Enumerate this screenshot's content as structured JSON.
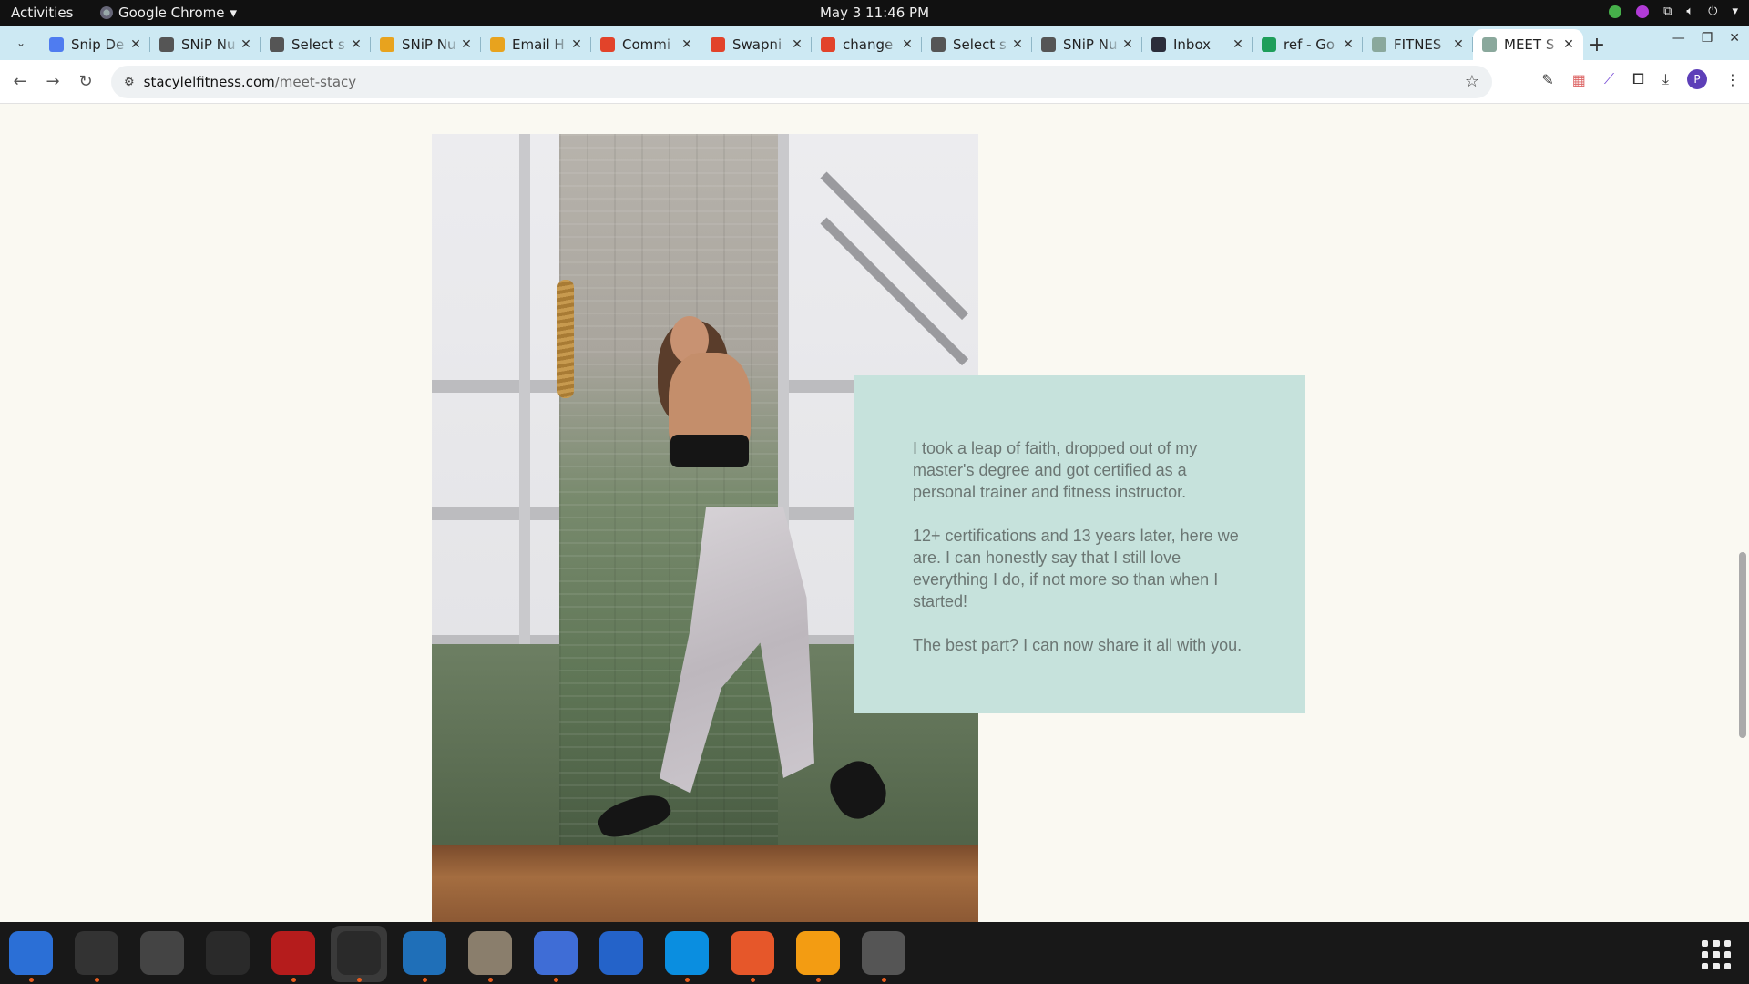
{
  "topbar": {
    "activities": "Activities",
    "app_name": "Google Chrome",
    "clock": "May 3  11:46 PM"
  },
  "tabs": [
    {
      "title": "Snip De",
      "favicon_color": "#4f7cf0",
      "favicon": "docs-icon"
    },
    {
      "title": "SNiP Nu",
      "favicon_color": "#555555",
      "favicon": "snip-icon"
    },
    {
      "title": "Select s",
      "favicon_color": "#555555",
      "favicon": "globe-icon"
    },
    {
      "title": "SNiP Nu",
      "favicon_color": "#e8a31e",
      "favicon": "chrome-icon"
    },
    {
      "title": "Email H",
      "favicon_color": "#e8a31e",
      "favicon": "chrome-icon"
    },
    {
      "title": "Commi",
      "favicon_color": "#e2432a",
      "favicon": "gitlab-icon"
    },
    {
      "title": "Swapni",
      "favicon_color": "#e2432a",
      "favicon": "gitlab-icon"
    },
    {
      "title": "change",
      "favicon_color": "#e2432a",
      "favicon": "gitlab-icon"
    },
    {
      "title": "Select s",
      "favicon_color": "#555555",
      "favicon": "globe-icon"
    },
    {
      "title": "SNiP Nu",
      "favicon_color": "#555555",
      "favicon": "snip-icon"
    },
    {
      "title": "Inbox",
      "favicon_color": "#2b2d3a",
      "favicon": "yahoo-icon"
    },
    {
      "title": "ref - Go",
      "favicon_color": "#1e9e5a",
      "favicon": "sheets-icon"
    },
    {
      "title": "FITNES",
      "favicon_color": "#8aa89c",
      "favicon": "site-icon"
    },
    {
      "title": "MEET S",
      "favicon_color": "#8aa89c",
      "favicon": "site-icon",
      "active": true
    }
  ],
  "toolbar": {
    "url_domain": "stacylelfitness.com",
    "url_path": "/meet-stacy",
    "avatar_letter": "P"
  },
  "content": {
    "para1": "I took a leap of faith, dropped out of my master's degree and got certified as a personal trainer and fitness instructor.",
    "para2": "12+ certifications and 13 years later, here we are. I can honestly say that I still love everything I do, if not more so than when I started!",
    "para3": "The best part? I can now share it all with you."
  },
  "colors": {
    "page_bg": "#faf9f2",
    "text_box_bg": "#c6e2dc",
    "text_color": "#6b7673",
    "tab_strip_bg": "#cde9f3"
  },
  "dock": [
    {
      "name": "thunderbird-icon",
      "color": "#2b6fd6",
      "running": true
    },
    {
      "name": "terminal-icon",
      "color": "#333333",
      "running": true
    },
    {
      "name": "calculator-icon",
      "color": "#444444",
      "running": false
    },
    {
      "name": "system-monitor-icon",
      "color": "#2a2a2a",
      "running": false
    },
    {
      "name": "filezilla-icon",
      "color": "#b51c1c",
      "running": true
    },
    {
      "name": "chrome-icon",
      "color": "#2a2a2a",
      "running": true,
      "active": true
    },
    {
      "name": "vscode-icon",
      "color": "#1f6fb8",
      "running": true
    },
    {
      "name": "files-icon",
      "color": "#8a7e6c",
      "running": true
    },
    {
      "name": "text-editor-icon",
      "color": "#3f6dd6",
      "running": true
    },
    {
      "name": "libreoffice-writer-icon",
      "color": "#2463c9",
      "running": false
    },
    {
      "name": "skype-icon",
      "color": "#0a8ee0",
      "running": true
    },
    {
      "name": "inkscape-pen-icon",
      "color": "#e6572a",
      "running": true
    },
    {
      "name": "blaze-icon",
      "color": "#f39c12",
      "running": true
    },
    {
      "name": "disc-icon",
      "color": "#555555",
      "running": true
    }
  ]
}
